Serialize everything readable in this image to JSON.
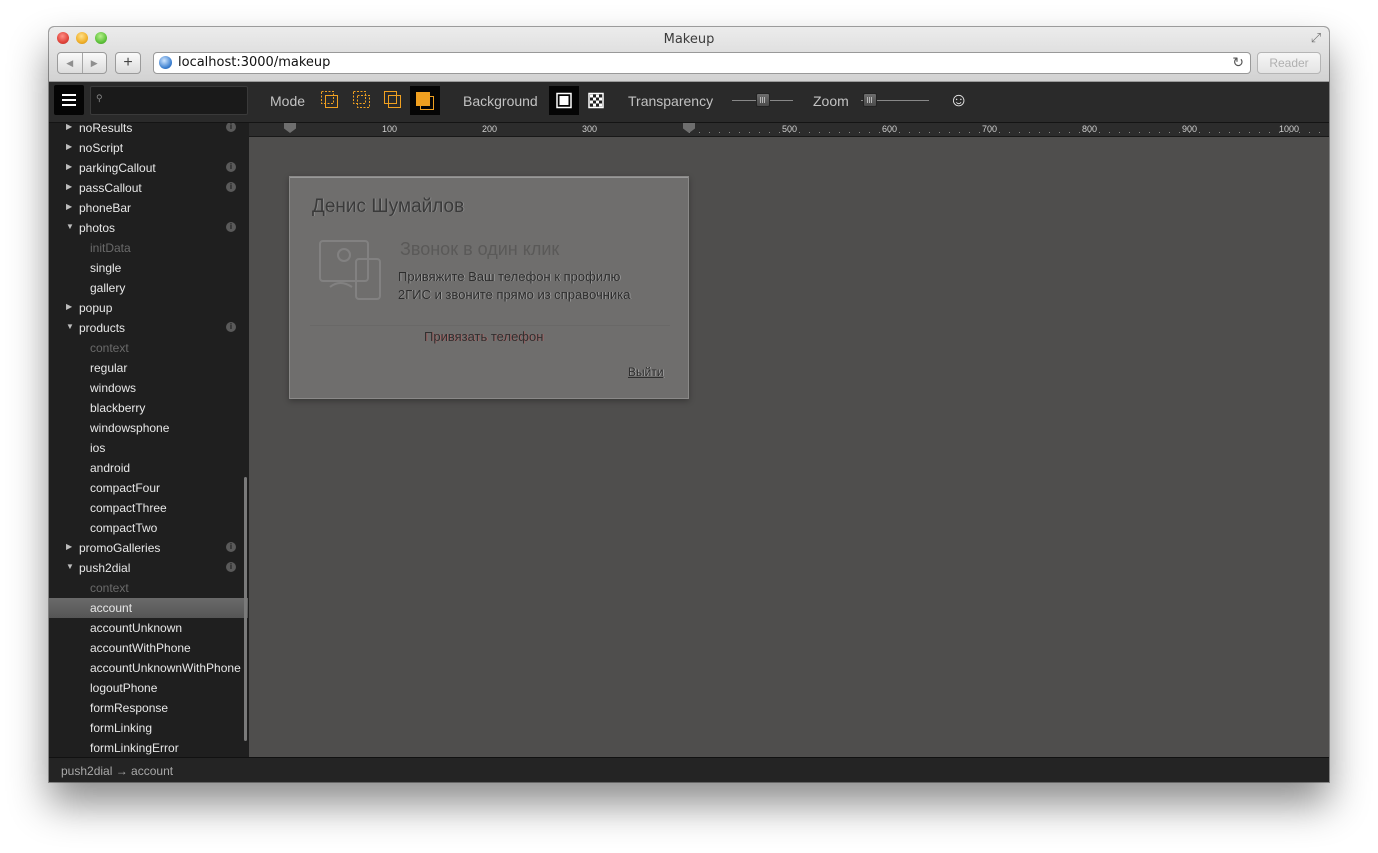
{
  "window": {
    "title": "Makeup"
  },
  "browser": {
    "url": "localhost:3000/makeup",
    "reader_label": "Reader"
  },
  "toolbar": {
    "mode_label": "Mode",
    "background_label": "Background",
    "transparency_label": "Transparency",
    "zoom_label": "Zoom",
    "transparency_value": 0.5,
    "zoom_value": 0.1,
    "active_mode": 4,
    "accent_color": "#f0a020"
  },
  "sidebar": {
    "items": [
      {
        "label": "noResults",
        "level": 0,
        "arrow": "right",
        "info": true
      },
      {
        "label": "noScript",
        "level": 0,
        "arrow": "right",
        "info": false
      },
      {
        "label": "parkingCallout",
        "level": 0,
        "arrow": "right",
        "info": true
      },
      {
        "label": "passCallout",
        "level": 0,
        "arrow": "right",
        "info": true
      },
      {
        "label": "phoneBar",
        "level": 0,
        "arrow": "right",
        "info": false
      },
      {
        "label": "photos",
        "level": 0,
        "arrow": "down",
        "info": true
      },
      {
        "label": "initData",
        "level": 1,
        "muted": true
      },
      {
        "label": "single",
        "level": 1
      },
      {
        "label": "gallery",
        "level": 1
      },
      {
        "label": "popup",
        "level": 0,
        "arrow": "right",
        "info": false
      },
      {
        "label": "products",
        "level": 0,
        "arrow": "down",
        "info": true
      },
      {
        "label": "context",
        "level": 1,
        "muted": true
      },
      {
        "label": "regular",
        "level": 1
      },
      {
        "label": "windows",
        "level": 1
      },
      {
        "label": "blackberry",
        "level": 1
      },
      {
        "label": "windowsphone",
        "level": 1
      },
      {
        "label": "ios",
        "level": 1
      },
      {
        "label": "android",
        "level": 1
      },
      {
        "label": "compactFour",
        "level": 1
      },
      {
        "label": "compactThree",
        "level": 1
      },
      {
        "label": "compactTwo",
        "level": 1
      },
      {
        "label": "promoGalleries",
        "level": 0,
        "arrow": "right",
        "info": true
      },
      {
        "label": "push2dial",
        "level": 0,
        "arrow": "down",
        "info": true
      },
      {
        "label": "context",
        "level": 1,
        "muted": true
      },
      {
        "label": "account",
        "level": 1,
        "selected": true
      },
      {
        "label": "accountUnknown",
        "level": 1
      },
      {
        "label": "accountWithPhone",
        "level": 1
      },
      {
        "label": "accountUnknownWithPhone",
        "level": 1
      },
      {
        "label": "logoutPhone",
        "level": 1
      },
      {
        "label": "formResponse",
        "level": 1
      },
      {
        "label": "formLinking",
        "level": 1
      },
      {
        "label": "formLinkingError",
        "level": 1
      }
    ]
  },
  "ruler": {
    "labels": [
      "100",
      "200",
      "300",
      "500",
      "600",
      "700",
      "800",
      "900",
      "1000"
    ]
  },
  "card": {
    "name": "Денис Шумайлов",
    "headline": "Звонок в один клик",
    "text_line1": "Привяжите Ваш телефон к профилю",
    "text_line2": "2ГИС и звоните прямо из справочника",
    "link_label": "Привязать телефон",
    "logout_label": "Выйти"
  },
  "status": {
    "breadcrumb": "push2dial → account"
  }
}
